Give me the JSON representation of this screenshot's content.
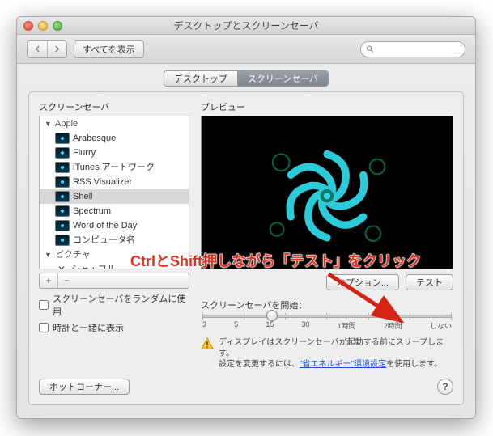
{
  "window": {
    "title": "デスクトップとスクリーンセーバ"
  },
  "toolbar": {
    "show_all": "すべてを表示"
  },
  "search": {
    "placeholder": ""
  },
  "tabs": {
    "desktop": "デスクトップ",
    "screensaver": "スクリーンセーバ"
  },
  "labels": {
    "screensaver_list": "スクリーンセーバ",
    "preview": "プレビュー",
    "random": "スクリーンセーバをランダムに使用",
    "show_clock": "時計と一緒に表示",
    "start_after": "スクリーンセーバを開始：",
    "hot_corners": "ホットコーナー...",
    "options": "オプション...",
    "test": "テスト"
  },
  "groups": {
    "apple": "Apple",
    "pictures": "ピクチャ"
  },
  "savers": [
    "Arabesque",
    "Flurry",
    "iTunes アートワーク",
    "RSS Visualizer",
    "Shell",
    "Spectrum",
    "Word of the Day",
    "コンピュータ名"
  ],
  "shuffle": "シャッフル",
  "slider": {
    "t3": "3",
    "t5": "5",
    "t15": "15",
    "t30": "30",
    "t1h": "1時間",
    "t2h": "2時間",
    "tnever": "しない"
  },
  "note": {
    "line1": "ディスプレイはスクリーンセーバが起動する前にスリープします。",
    "line2a": "設定を変更するには、",
    "link": "\"省エネルギー\"環境設定",
    "line2b": "を使用します。"
  },
  "annotation": {
    "text": "CtrlとShift押しながら「テスト」をクリック"
  }
}
